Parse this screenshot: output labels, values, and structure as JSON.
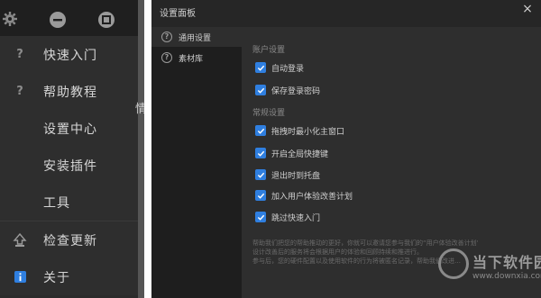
{
  "menu": {
    "items": [
      {
        "label": "快速入门",
        "icon": "question-icon"
      },
      {
        "label": "帮助教程",
        "icon": "question-icon"
      },
      {
        "label": "设置中心",
        "icon": ""
      },
      {
        "label": "安装插件",
        "icon": ""
      },
      {
        "label": "工具",
        "icon": ""
      },
      {
        "label": "检查更新",
        "icon": "upload-icon"
      },
      {
        "label": "关于",
        "icon": "info-icon"
      }
    ],
    "partial_text": "情"
  },
  "dialog": {
    "title": "设置面板",
    "close_glyph": "×",
    "nav": [
      {
        "label": "通用设置",
        "icon": "question-circle-icon"
      },
      {
        "label": "素材库",
        "icon": "question-circle-icon"
      }
    ],
    "sections": [
      {
        "title": "账户设置",
        "options": [
          {
            "label": "自动登录",
            "checked": true
          },
          {
            "label": "保存登录密码",
            "checked": true
          }
        ]
      },
      {
        "title": "常规设置",
        "options": [
          {
            "label": "拖拽时最小化主窗口",
            "checked": true
          },
          {
            "label": "开启全局快捷键",
            "checked": true
          },
          {
            "label": "退出时到托盘",
            "checked": true
          },
          {
            "label": "加入用户体验改善计划",
            "checked": true
          },
          {
            "label": "跳过快速入门",
            "checked": true
          }
        ]
      }
    ],
    "note_lines": [
      "帮助我们把您的帮助推动的更好，你就可以邀请您参与我们的“用户体验改善计划”，",
      "设计改善后的服务将会根据用户的体验和回顾持续和推进行。",
      "参与后，您的硬件配置以及使用软件的行为将被匿名记录，帮助我们改进…"
    ]
  },
  "watermark": {
    "text": "当下软件园",
    "url": "www.downxia.com"
  },
  "colors": {
    "checkbox": "#2f7fe0",
    "menu_bg": "#2e2e2e",
    "dialog_bg": "#262626"
  }
}
